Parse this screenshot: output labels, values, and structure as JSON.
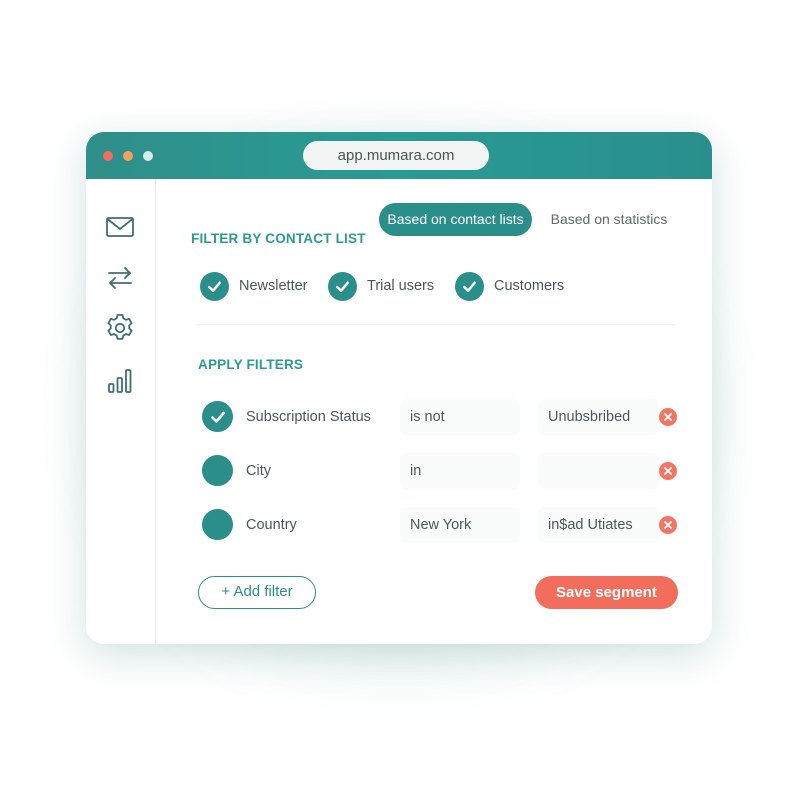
{
  "browser": {
    "url": "app.mumara.com"
  },
  "sidebar": {
    "items": [
      {
        "icon": "mail-icon"
      },
      {
        "icon": "swap-arrows-icon"
      },
      {
        "icon": "gear-icon"
      },
      {
        "icon": "bar-chart-icon"
      }
    ]
  },
  "segmented": {
    "active": "Based on contact lists",
    "inactive": "Based on statistics"
  },
  "contact_list": {
    "title": "FILTER BY CONTACT LIST",
    "items": [
      {
        "label": "Newsletter",
        "checked": true
      },
      {
        "label": "Trial users",
        "checked": true
      },
      {
        "label": "Customers",
        "checked": true
      }
    ]
  },
  "filters": {
    "title": "APPLY FILTERS",
    "rows": [
      {
        "field": "Subscription Status",
        "operator": "is not",
        "value": "Unubsbribed",
        "checked": true
      },
      {
        "field": "City",
        "operator": "in",
        "value": "",
        "checked": false
      },
      {
        "field": "Country",
        "operator": "New York",
        "value": "in$ad Utiates",
        "checked": false
      }
    ]
  },
  "actions": {
    "add_filter": "+ Add filter",
    "save_segment": "Save segment"
  },
  "colors": {
    "teal": "#2a8f8a",
    "accent_red": "#f26d5b"
  }
}
